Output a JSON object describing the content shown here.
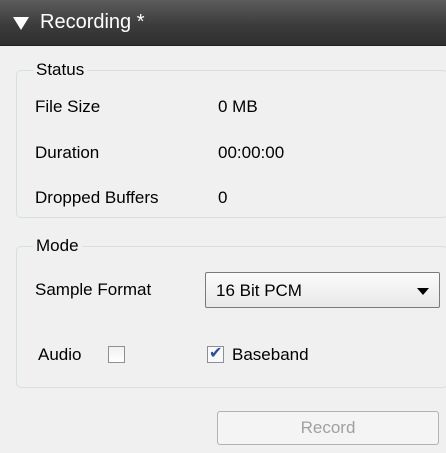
{
  "header": {
    "title": "Recording *"
  },
  "status": {
    "title": "Status",
    "rows": [
      {
        "label": "File Size",
        "value": "0 MB"
      },
      {
        "label": "Duration",
        "value": "00:00:00"
      },
      {
        "label": "Dropped Buffers",
        "value": "0"
      }
    ]
  },
  "mode": {
    "title": "Mode",
    "sample_format_label": "Sample Format",
    "sample_format_value": "16 Bit PCM",
    "audio_label": "Audio",
    "audio_checked": false,
    "baseband_label": "Baseband",
    "baseband_checked": true
  },
  "actions": {
    "record_label": "Record",
    "record_enabled": false
  },
  "icons": {
    "header_arrow": "triangle-down-icon",
    "dropdown_arrow": "chevron-down-icon",
    "check": "check-icon"
  }
}
